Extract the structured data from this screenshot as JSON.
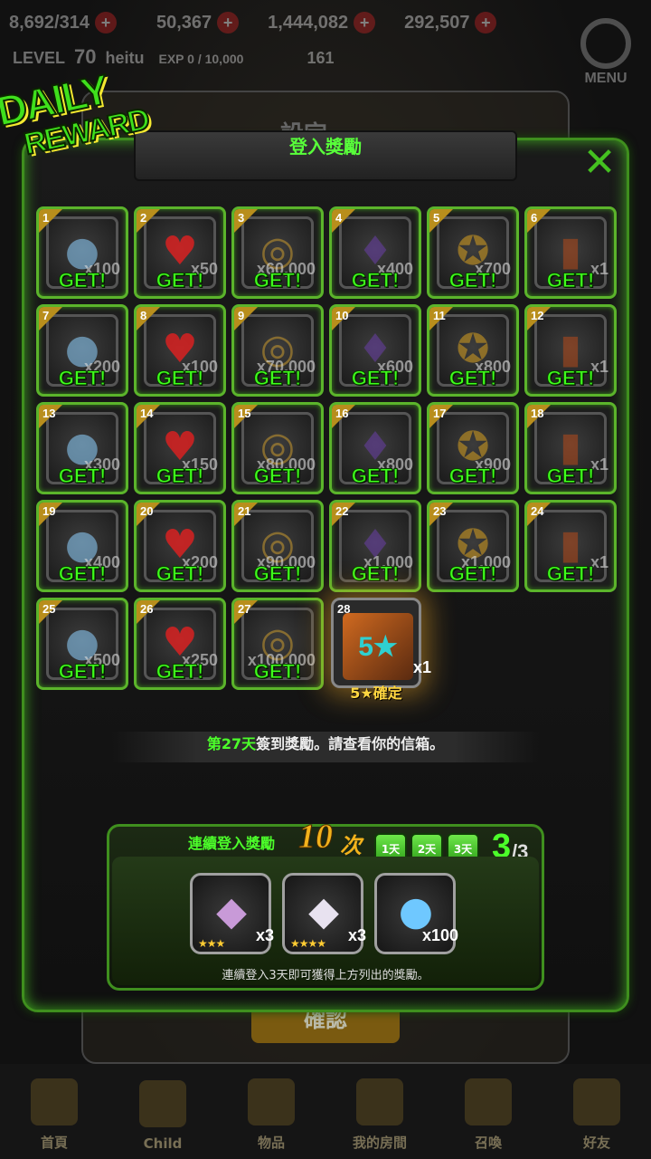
{
  "background": {
    "resources": [
      "8,692/314",
      "50,367",
      "1,444,082",
      "292,507"
    ],
    "level_label": "LEVEL",
    "level_value": "70",
    "player_name": "heitu",
    "exp_text": "EXP 0 / 10,000",
    "stamina": "161",
    "menu_label": "MENU",
    "settings_title": "設定",
    "settings_ok": "確認"
  },
  "bottom_nav": [
    {
      "label": "首頁",
      "icon": "home-icon"
    },
    {
      "label": "Child",
      "icon": "flame-icon"
    },
    {
      "label": "物品",
      "icon": "sword-shield-icon"
    },
    {
      "label": "我的房間",
      "icon": "crown-icon"
    },
    {
      "label": "召喚",
      "icon": "summon-icon"
    },
    {
      "label": "好友",
      "icon": "shield-icon"
    }
  ],
  "badge": {
    "line1": "DAILY",
    "line2": "REWARD"
  },
  "modal": {
    "title": "登入獎勵",
    "close_icon": "close-icon",
    "get_label": "GET!",
    "days": [
      {
        "day": "1",
        "type": "gem",
        "qty": "x100"
      },
      {
        "day": "2",
        "type": "heart",
        "qty": "x50"
      },
      {
        "day": "3",
        "type": "coin",
        "qty": "x60,000"
      },
      {
        "day": "4",
        "type": "crystal",
        "qty": "x400"
      },
      {
        "day": "5",
        "type": "medal",
        "qty": "x700"
      },
      {
        "day": "6",
        "type": "ticket",
        "qty": "x1"
      },
      {
        "day": "7",
        "type": "gem",
        "qty": "x200"
      },
      {
        "day": "8",
        "type": "heart",
        "qty": "x100"
      },
      {
        "day": "9",
        "type": "coin",
        "qty": "x70,000"
      },
      {
        "day": "10",
        "type": "crystal",
        "qty": "x600"
      },
      {
        "day": "11",
        "type": "medal",
        "qty": "x800"
      },
      {
        "day": "12",
        "type": "ticket",
        "qty": "x1"
      },
      {
        "day": "13",
        "type": "gem",
        "qty": "x300"
      },
      {
        "day": "14",
        "type": "heart",
        "qty": "x150"
      },
      {
        "day": "15",
        "type": "coin",
        "qty": "x80,000"
      },
      {
        "day": "16",
        "type": "crystal",
        "qty": "x800"
      },
      {
        "day": "17",
        "type": "medal",
        "qty": "x900"
      },
      {
        "day": "18",
        "type": "ticket",
        "qty": "x1"
      },
      {
        "day": "19",
        "type": "gem",
        "qty": "x400"
      },
      {
        "day": "20",
        "type": "heart",
        "qty": "x200"
      },
      {
        "day": "21",
        "type": "coin",
        "qty": "x90,000"
      },
      {
        "day": "22",
        "type": "crystal",
        "qty": "x1,000"
      },
      {
        "day": "23",
        "type": "medal",
        "qty": "x1,000"
      },
      {
        "day": "24",
        "type": "ticket",
        "qty": "x1"
      },
      {
        "day": "25",
        "type": "gem",
        "qty": "x500"
      },
      {
        "day": "26",
        "type": "heart",
        "qty": "x250"
      },
      {
        "day": "27",
        "type": "coin",
        "qty": "x100,000"
      }
    ],
    "today": {
      "day": "28",
      "qty": "x1",
      "label": "5★確定",
      "item_text": "5★"
    },
    "message_highlight": "第27天",
    "message_rest": "簽到獎勵。請查看你的信箱。"
  },
  "consecutive": {
    "title": "連續登入獎勵",
    "count": "10",
    "unit": "次",
    "day_buttons": [
      "1天",
      "2天",
      "3天"
    ],
    "progress_current": "3",
    "progress_total": "/3",
    "rewards": [
      {
        "icon": "purple-diamond-icon",
        "stars": "★★★",
        "qty": "x3"
      },
      {
        "icon": "white-diamond-icon",
        "stars": "★★★★",
        "qty": "x3"
      },
      {
        "icon": "rainbow-gem-icon",
        "stars": "",
        "qty": "x100"
      }
    ],
    "note": "連續登入3天即可獲得上方列出的獎勵。"
  },
  "colors": {
    "accent_green": "#4cff2a",
    "frame_green": "#3f8f1e",
    "gold": "#f2b21c"
  }
}
